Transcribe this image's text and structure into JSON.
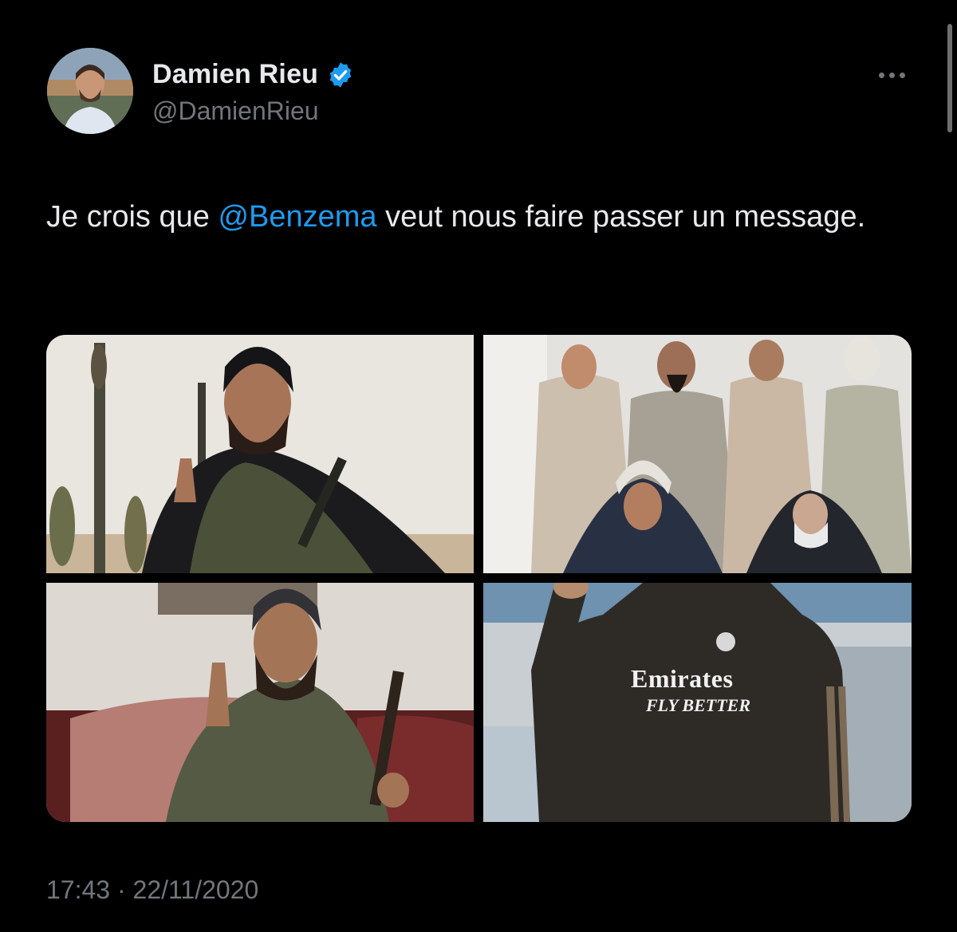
{
  "author": {
    "display_name": "Damien Rieu",
    "handle": "@DamienRieu",
    "verified": true
  },
  "tweet": {
    "text_before": "Je crois que ",
    "mention": "@Benzema",
    "text_after": " veut nous faire passer un message."
  },
  "media": {
    "photo_4_brand": "Emirates",
    "photo_4_slogan": "FLY BETTER"
  },
  "meta": {
    "timestamp": "17:43 · 22/11/2020"
  },
  "icons": {
    "verified": "verified-badge-icon",
    "more": "more-options-icon"
  },
  "colors": {
    "background": "#000000",
    "text": "#e7e9ea",
    "secondary": "#71767b",
    "accent": "#1d9bf0"
  }
}
